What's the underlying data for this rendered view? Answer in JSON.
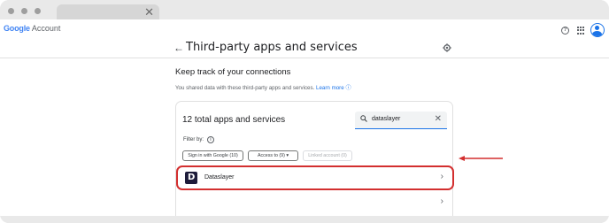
{
  "browser": {
    "tab_close": "✕"
  },
  "header": {
    "logo_google": "Google",
    "logo_account": "Account",
    "help_icon": "?"
  },
  "page": {
    "back_arrow": "←",
    "title": "Third-party apps and services",
    "subheading": "Keep track of your connections",
    "description": "You shared data with these third-party apps and services.",
    "learn_more": "Learn more"
  },
  "card": {
    "title": "12 total apps and services",
    "search": {
      "value": "dataslayer",
      "clear": "✕"
    },
    "filter_label": "Filter by:",
    "info_icon": "i",
    "chips": [
      {
        "label": "Sign in with Google (10)"
      },
      {
        "label": "Access to (9)  ▾"
      },
      {
        "label": "Linked account (0)"
      }
    ],
    "rows": [
      {
        "name": "Dataslayer",
        "icon_letter": "D",
        "chevron": "›"
      },
      {
        "name": "",
        "chevron": "›"
      }
    ]
  },
  "colors": {
    "accent": "#1a73e8",
    "highlight": "#d32f2f"
  }
}
